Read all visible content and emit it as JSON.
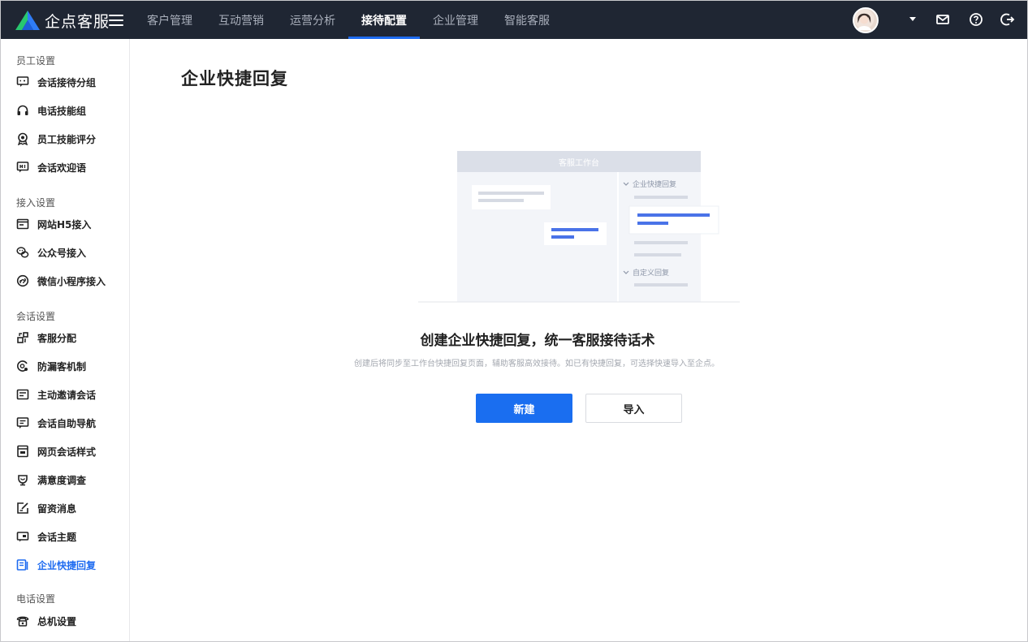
{
  "app": {
    "name": "企点客服"
  },
  "nav": {
    "items": [
      {
        "label": "客户管理",
        "active": false
      },
      {
        "label": "互动营销",
        "active": false
      },
      {
        "label": "运营分析",
        "active": false
      },
      {
        "label": "接待配置",
        "active": true
      },
      {
        "label": "企业管理",
        "active": false
      },
      {
        "label": "智能客服",
        "active": false
      }
    ]
  },
  "sidebar": {
    "groups": [
      {
        "title": "员工设置",
        "items": [
          "会话接待分组",
          "电话技能组",
          "员工技能评分",
          "会话欢迎语"
        ]
      },
      {
        "title": "接入设置",
        "items": [
          "网站H5接入",
          "公众号接入",
          "微信小程序接入"
        ]
      },
      {
        "title": "会话设置",
        "items": [
          "客服分配",
          "防漏客机制",
          "主动邀请会话",
          "会话自助导航",
          "网页会话样式",
          "满意度调查",
          "留资消息",
          "会话主题",
          "企业快捷回复"
        ]
      },
      {
        "title": "电话设置",
        "items": [
          "总机设置"
        ]
      }
    ],
    "active_item": "企业快捷回复"
  },
  "main": {
    "title": "企业快捷回复",
    "illustration": {
      "window_title": "客服工作台",
      "section_1": "企业快捷回复",
      "section_2": "自定义回复"
    },
    "headline": "创建企业快捷回复，统一客服接待话术",
    "description": "创建后将同步至工作台快捷回复页面，辅助客服高效接待。如已有快捷回复，可选择快速导入至企点。",
    "buttons": {
      "create": "新建",
      "import": "导入"
    }
  },
  "colors": {
    "accent": "#1a6ef0",
    "topbar": "#1f2633"
  }
}
